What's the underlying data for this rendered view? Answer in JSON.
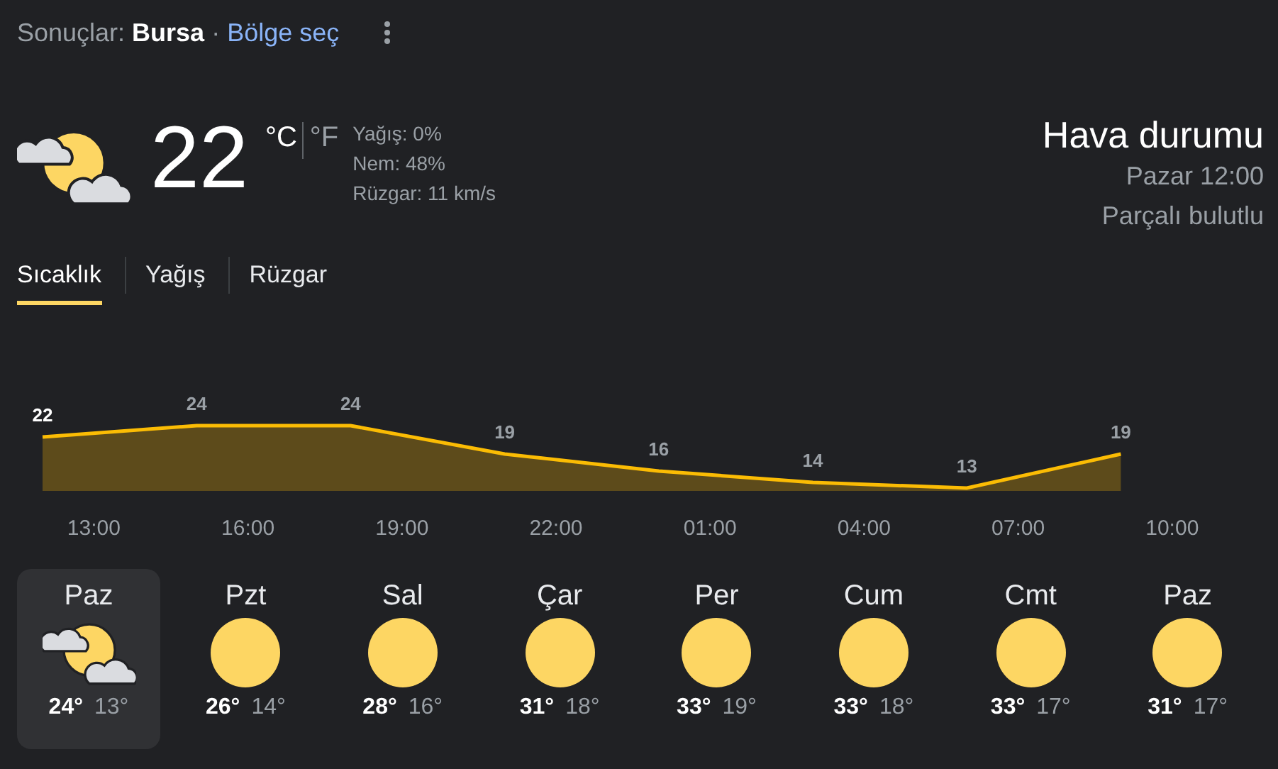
{
  "header": {
    "prefix": "Sonuçlar:",
    "location": "Bursa",
    "separator": "·",
    "region_link": "Bölge seç"
  },
  "current": {
    "temperature": "22",
    "units": [
      {
        "label": "°C",
        "selected": true
      },
      {
        "label": "°F",
        "selected": false
      }
    ],
    "details": [
      "Yağış: 0%",
      "Nem: 48%",
      "Rüzgar: 11 km/s"
    ]
  },
  "summary": {
    "title": "Hava durumu",
    "time": "Pazar 12:00",
    "condition": "Parçalı bulutlu"
  },
  "tabs": [
    {
      "label": "Sıcaklık",
      "selected": true
    },
    {
      "label": "Yağış",
      "selected": false
    },
    {
      "label": "Rüzgar",
      "selected": false
    }
  ],
  "chart": {
    "chart_data": {
      "type": "area",
      "data_labels": true,
      "categories": [
        null,
        "13:00",
        null,
        null,
        "16:00",
        null,
        null,
        "19:00",
        null,
        null,
        "22:00",
        null,
        null,
        "01:00",
        null,
        null,
        "04:00",
        null,
        null,
        "07:00",
        null,
        null,
        "10:00",
        null,
        null
      ],
      "series": [
        {
          "color": "#fbbc04",
          "values": [
            22,
            null,
            null,
            24,
            null,
            null,
            24,
            null,
            null,
            19,
            null,
            null,
            16,
            null,
            null,
            14,
            null,
            null,
            13,
            null,
            null,
            19,
            null,
            null,
            null
          ]
        }
      ]
    }
  },
  "days": [
    {
      "name": "Paz",
      "kind": "cloudy",
      "high": "24°",
      "low": "13°",
      "selected": true
    },
    {
      "name": "Pzt",
      "kind": "sunny",
      "high": "26°",
      "low": "14°",
      "selected": false
    },
    {
      "name": "Sal",
      "kind": "sunny",
      "high": "28°",
      "low": "16°",
      "selected": false
    },
    {
      "name": "Çar",
      "kind": "sunny",
      "high": "31°",
      "low": "18°",
      "selected": false
    },
    {
      "name": "Per",
      "kind": "sunny",
      "high": "33°",
      "low": "19°",
      "selected": false
    },
    {
      "name": "Cum",
      "kind": "sunny",
      "high": "33°",
      "low": "18°",
      "selected": false
    },
    {
      "name": "Cmt",
      "kind": "sunny",
      "high": "33°",
      "low": "17°",
      "selected": false
    },
    {
      "name": "Paz",
      "kind": "sunny",
      "high": "31°",
      "low": "17°",
      "selected": false
    }
  ]
}
